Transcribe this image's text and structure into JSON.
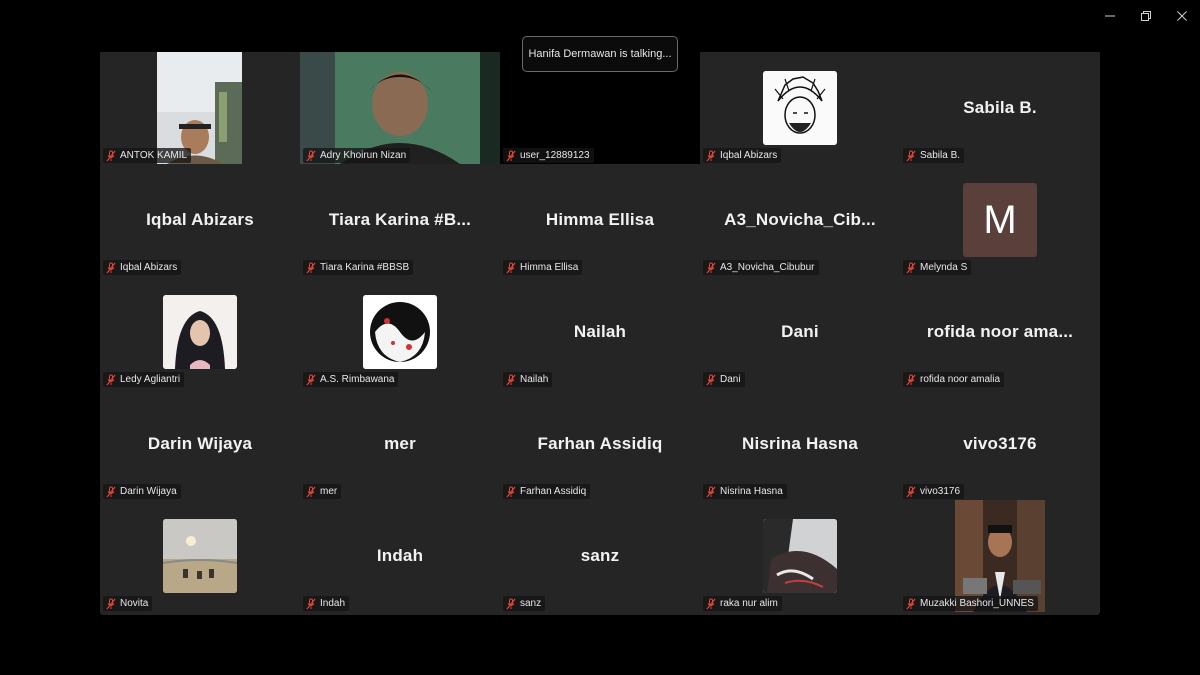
{
  "window_controls": {
    "minimize_icon": "minimize-icon",
    "restore_icon": "restore-icon",
    "close_icon": "close-icon"
  },
  "talking_indicator": "Hanifa Dermawan is talking...",
  "colors": {
    "mute_icon": "#e0453a",
    "tile_bg": "#252525",
    "initial_avatar_bg": "#5a3f3a"
  },
  "participants": [
    {
      "label": "ANTOK KAMIL",
      "display": "",
      "type": "video"
    },
    {
      "label": "Adry Khoirun Nizan",
      "display": "",
      "type": "video"
    },
    {
      "label": "user_12889123",
      "display": "",
      "type": "video"
    },
    {
      "label": "Iqbal Abizars",
      "display": "",
      "type": "avatar"
    },
    {
      "label": "Sabila B.",
      "display": "Sabila B.",
      "type": "name"
    },
    {
      "label": "Iqbal Abizars",
      "display": "Iqbal Abizars",
      "type": "name"
    },
    {
      "label": "Tiara Karina #BBSB",
      "display": "Tiara Karina #B...",
      "type": "name"
    },
    {
      "label": "Himma Ellisa",
      "display": "Himma Ellisa",
      "type": "name"
    },
    {
      "label": "A3_Novicha_Cibubur",
      "display": "A3_Novicha_Cib...",
      "type": "name"
    },
    {
      "label": "Melynda S",
      "display": "M",
      "type": "initial"
    },
    {
      "label": "Ledy Agliantri",
      "display": "",
      "type": "avatar"
    },
    {
      "label": "A.S. Rimbawana",
      "display": "",
      "type": "avatar"
    },
    {
      "label": "Nailah",
      "display": "Nailah",
      "type": "name"
    },
    {
      "label": "Dani",
      "display": "Dani",
      "type": "name"
    },
    {
      "label": "rofida noor amalia",
      "display": "rofida noor ama...",
      "type": "name"
    },
    {
      "label": "Darin Wijaya",
      "display": "Darin Wijaya",
      "type": "name"
    },
    {
      "label": "mer",
      "display": "mer",
      "type": "name"
    },
    {
      "label": "Farhan Assidiq",
      "display": "Farhan Assidiq",
      "type": "name"
    },
    {
      "label": "Nisrina Hasna",
      "display": "Nisrina Hasna",
      "type": "name"
    },
    {
      "label": "vivo3176",
      "display": "vivo3176",
      "type": "name"
    },
    {
      "label": "Novita",
      "display": "",
      "type": "avatar"
    },
    {
      "label": "Indah",
      "display": "Indah",
      "type": "name"
    },
    {
      "label": "sanz",
      "display": "sanz",
      "type": "name"
    },
    {
      "label": "raka nur alim",
      "display": "",
      "type": "avatar"
    },
    {
      "label": "Muzakki Bashori_UNNES",
      "display": "",
      "type": "video"
    }
  ]
}
